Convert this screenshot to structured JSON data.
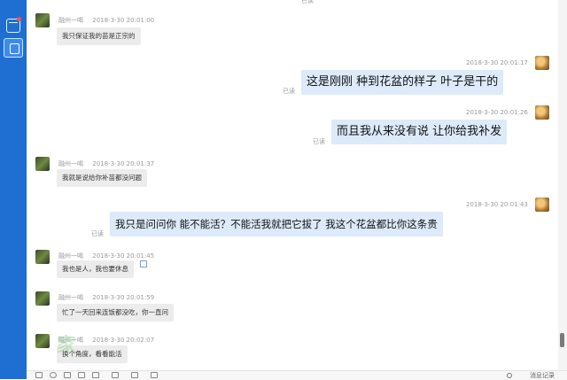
{
  "sidebar": {
    "items": [
      {
        "icon": "calendar-icon"
      },
      {
        "icon": "contacts-icon"
      }
    ]
  },
  "messages": [
    {
      "side": "left",
      "name": "融州一喝",
      "time": "2018-3-30 20:01:00",
      "text": "我只保证我的苗是正宗的"
    },
    {
      "side": "right",
      "time": "2018-3-30 20:01:17",
      "text": "这是刚刚 种到花盆的样子 叶子是干的",
      "status": "已读"
    },
    {
      "side": "right",
      "time": "2018-3-30 20:01:26",
      "text": "而且我从来没有说 让你给我补发",
      "status": "已读"
    },
    {
      "side": "left",
      "name": "融州一喝",
      "time": "2018-3-30 20:01:37",
      "text": "我就是说给你补苗都没问题"
    },
    {
      "side": "right",
      "time": "2018-3-30 20:01:43",
      "text": "我只是问问你 能不能活？不能活我就把它拔了 我这个花盆都比你这条贵",
      "status": "已读"
    },
    {
      "side": "left",
      "name": "融州一喝",
      "time": "2018-3-30 20:01:45",
      "text": "我也是人，我也要休息"
    },
    {
      "side": "left",
      "name": "融州一喝",
      "time": "2018-3-30 20:01:59",
      "text": "忙了一天回来连饭都没吃，你一直问"
    },
    {
      "side": "left",
      "name": "融州一喝",
      "time": "2018-3-30 20:02:07",
      "text": "换个角度，看看能活"
    }
  ],
  "top_status": "已读",
  "toolbar": {
    "history_label": "消息记录"
  },
  "watermark": "家"
}
